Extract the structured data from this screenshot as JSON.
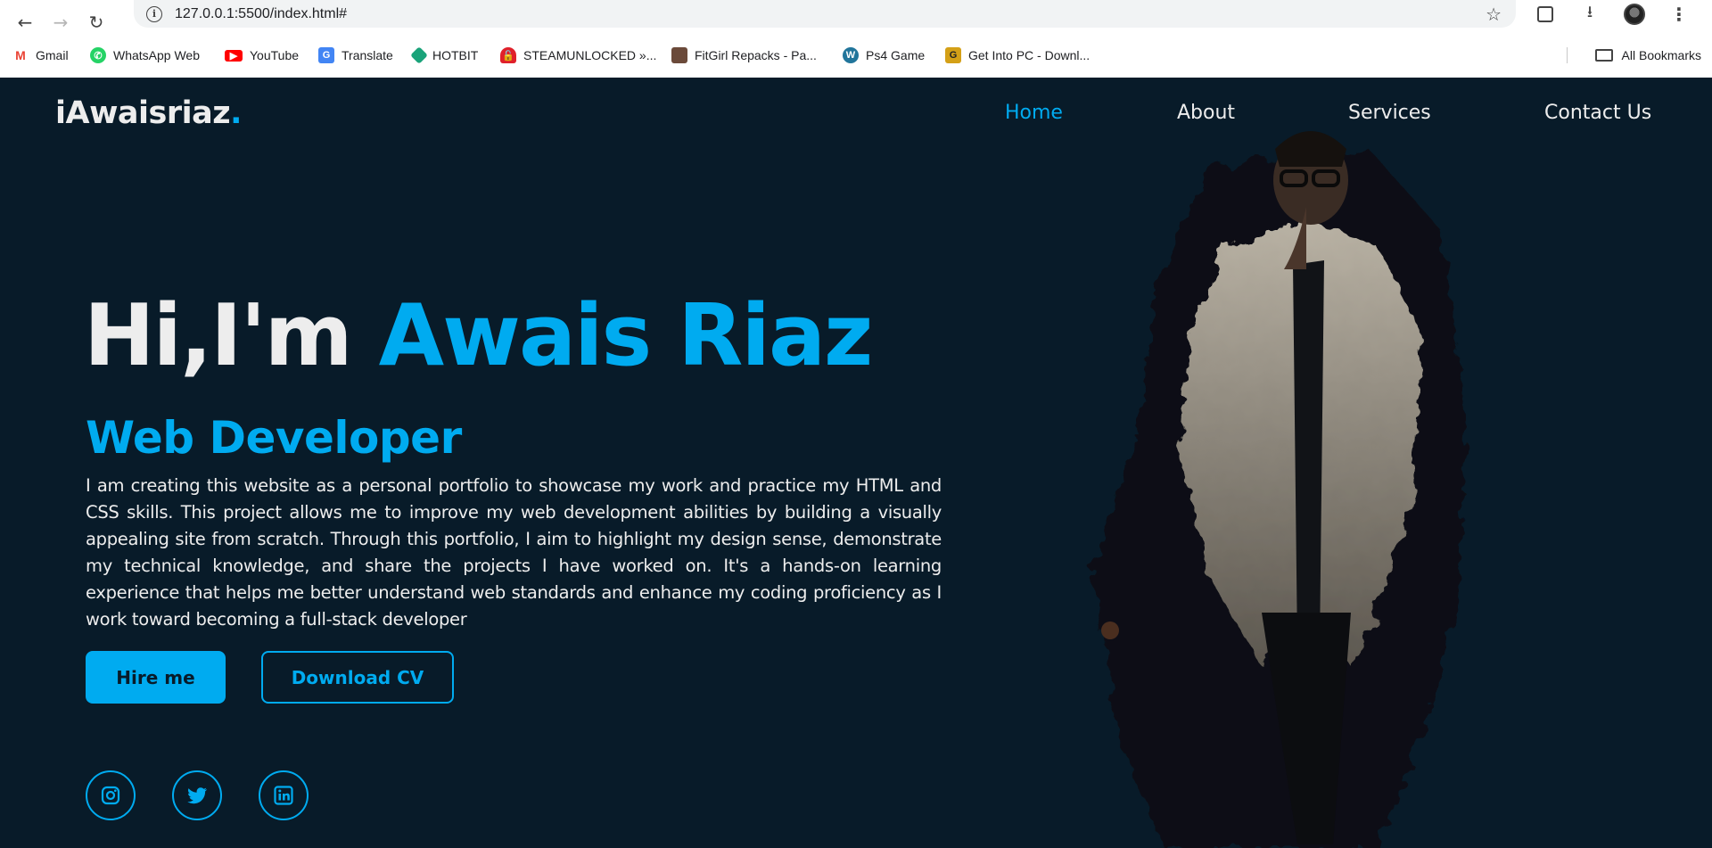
{
  "browser": {
    "url": "127.0.0.1:5500/index.html#",
    "bookmarks": [
      {
        "label": "Gmail",
        "icon": "gmail-icon",
        "color": "#ea4335"
      },
      {
        "label": "WhatsApp Web",
        "icon": "whatsapp-icon",
        "color": "#25d366"
      },
      {
        "label": "YouTube",
        "icon": "youtube-icon",
        "color": "#ff0000"
      },
      {
        "label": "Translate",
        "icon": "translate-icon",
        "color": "#4285f4"
      },
      {
        "label": "HOTBIT",
        "icon": "hotbit-icon",
        "color": "#1aa37a"
      },
      {
        "label": "STEAMUNLOCKED »...",
        "icon": "steamunlocked-icon",
        "color": "#e0202a"
      },
      {
        "label": "FitGirl Repacks - Pa...",
        "icon": "fitgirl-icon",
        "color": "#6b4a3a"
      },
      {
        "label": "Ps4 Game",
        "icon": "wordpress-icon",
        "color": "#21759b"
      },
      {
        "label": "Get Into PC - Downl...",
        "icon": "getintopc-icon",
        "color": "#d4a017"
      }
    ],
    "all_bookmarks": "All Bookmarks"
  },
  "site": {
    "logo_text": "iAwaisriaz",
    "logo_dot": ".",
    "nav": [
      {
        "label": "Home",
        "active": true
      },
      {
        "label": "About",
        "active": false
      },
      {
        "label": "Services",
        "active": false
      },
      {
        "label": "Contact Us",
        "active": false
      }
    ],
    "greeting": "Hi,I'm ",
    "name": "Awais Riaz",
    "role": "Web Developer",
    "intro": "I am creating this website as a personal portfolio to showcase my work and practice my HTML and CSS skills. This project allows me to improve my web development abilities by building a visually appealing site from scratch. Through this portfolio, I aim to highlight my design sense, demonstrate my technical knowledge, and share the projects I have worked on. It's a hands-on learning experience that helps me better understand web standards and enhance my coding proficiency as I work toward becoming a full-stack developer",
    "hire_label": "Hire me",
    "cv_label": "Download CV",
    "socials": [
      "instagram-icon",
      "twitter-icon",
      "linkedin-icon"
    ]
  },
  "colors": {
    "background": "#081b29",
    "accent": "#00abf0",
    "text": "#ededed"
  }
}
